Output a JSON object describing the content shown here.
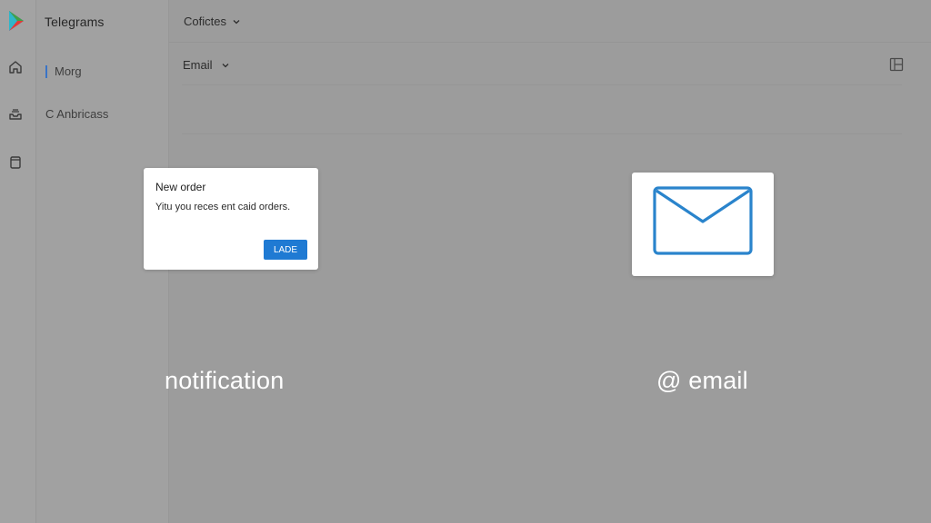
{
  "app": {
    "title": "Telegrams"
  },
  "rail": {
    "icons": [
      "play-logo-icon",
      "home-icon",
      "inbox-icon",
      "document-icon"
    ]
  },
  "sidebar": {
    "items": [
      {
        "label": "Morg",
        "active": true
      },
      {
        "label": "C Anbricass",
        "active": false
      }
    ]
  },
  "topbar": {
    "dropdown_label": "Cofictes"
  },
  "filterbar": {
    "dropdown_label": "Email"
  },
  "notification": {
    "title": "New order",
    "body": "Yitu you reces ent caid orders.",
    "button_label": "LADE"
  },
  "captions": {
    "left": "notification",
    "right": "@ email"
  },
  "colors": {
    "accent": "#1f7ad3",
    "active_indicator": "#3a74c6",
    "background": "#9e9e9e",
    "card": "#ffffff"
  }
}
